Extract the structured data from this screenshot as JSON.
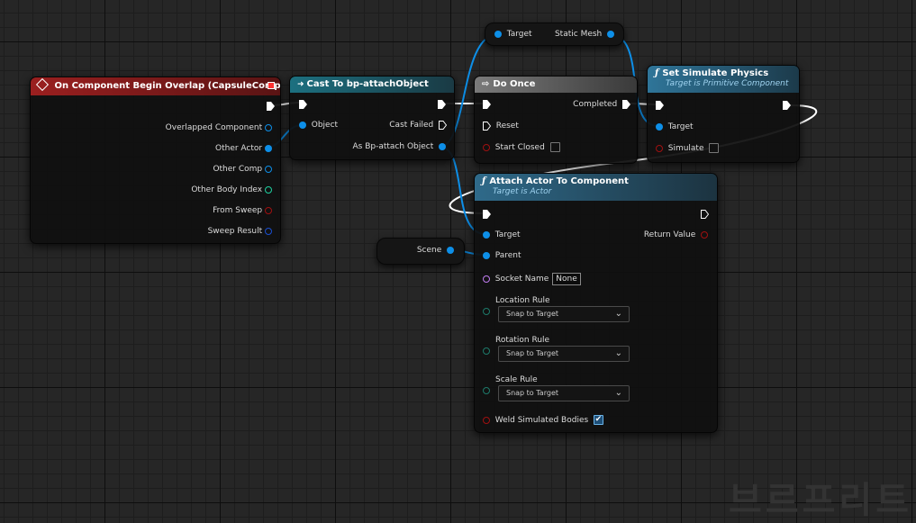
{
  "colors": {
    "event_header": "#8f1d1d",
    "cast_header": "#1b5e6e",
    "macro_header": "#6a6a6a",
    "function_header": "#2f6a8a",
    "object_pin": "#0d8fe8",
    "exec_pin": "#ffffff"
  },
  "event_node": {
    "title": "On Component Begin Overlap (CapsuleComponent)",
    "outputs": [
      "Overlapped Component",
      "Other Actor",
      "Other Comp",
      "Other Body Index",
      "From Sweep",
      "Sweep Result"
    ]
  },
  "cast_node": {
    "title": "Cast To bp-attachObject",
    "input_object": "Object",
    "cast_failed": "Cast Failed",
    "as_output": "As Bp-attach Object"
  },
  "static_mesh_var": {
    "target": "Target",
    "label": "Static Mesh"
  },
  "do_once": {
    "title": "Do Once",
    "completed": "Completed",
    "reset": "Reset",
    "start_closed": "Start Closed"
  },
  "set_physics": {
    "title": "Set Simulate Physics",
    "subtitle": "Target is Primitive Component",
    "target": "Target",
    "simulate": "Simulate"
  },
  "scene_var": {
    "label": "Scene"
  },
  "attach_node": {
    "title": "Attach Actor To Component",
    "subtitle": "Target is Actor",
    "target": "Target",
    "return_value": "Return Value",
    "parent": "Parent",
    "socket_name": "Socket Name",
    "socket_value": "None",
    "location_rule": "Location Rule",
    "location_value": "Snap to Target",
    "rotation_rule": "Rotation Rule",
    "rotation_value": "Snap to Target",
    "scale_rule": "Scale Rule",
    "scale_value": "Snap to Target",
    "weld": "Weld Simulated Bodies",
    "weld_checked": true
  },
  "watermark": "브르프리트"
}
